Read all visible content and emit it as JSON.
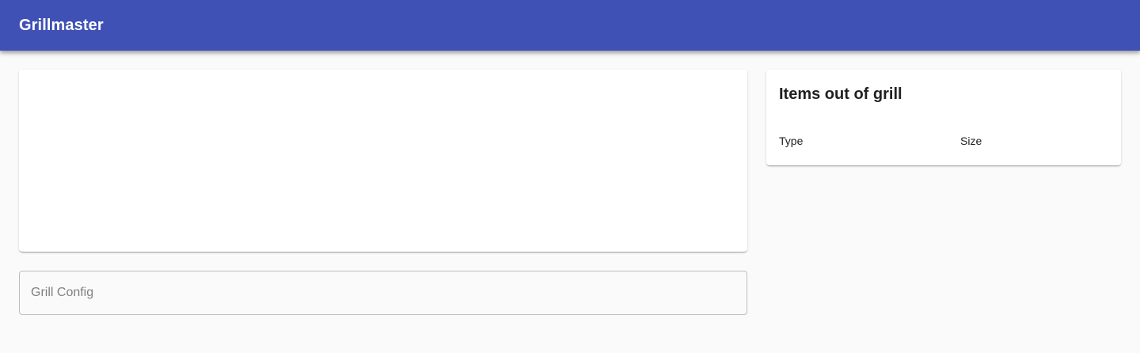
{
  "app_bar": {
    "title": "Grillmaster",
    "color": "#3f51b5"
  },
  "grill_config": {
    "placeholder": "Grill Config",
    "value": ""
  },
  "items_out": {
    "title": "Items out of grill",
    "columns": [
      "Type",
      "Size"
    ],
    "rows": []
  }
}
